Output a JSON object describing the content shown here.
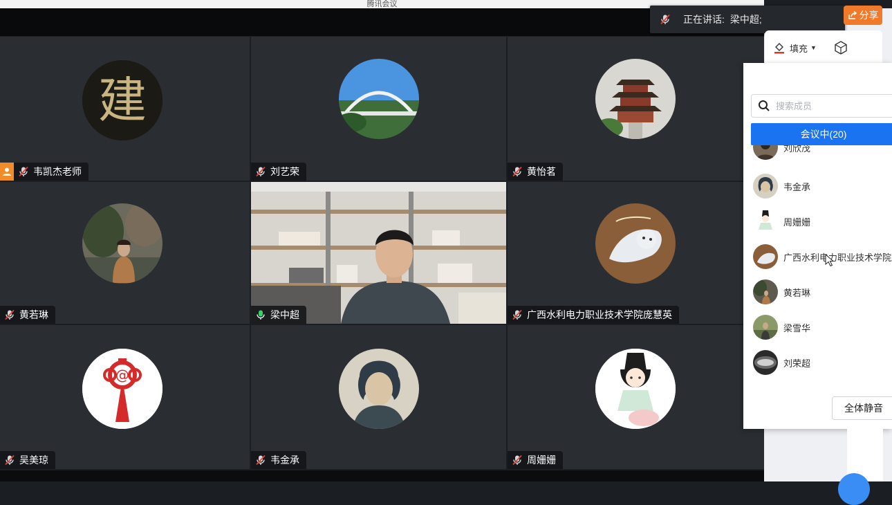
{
  "window": {
    "title": "腾讯会议"
  },
  "speaking": {
    "label": "正在讲话:",
    "name": "梁中超;"
  },
  "toolbar": {
    "share_label": "分享",
    "fill_label": "填充"
  },
  "tiles": [
    {
      "name": "韦凯杰老师",
      "mic": "muted",
      "host": true,
      "avatar": "calligraphy-avatar"
    },
    {
      "name": "刘艺荣",
      "mic": "muted",
      "host": false,
      "avatar": "bridge-avatar"
    },
    {
      "name": "黄怡茗",
      "mic": "muted",
      "host": false,
      "avatar": "pavilion-avatar"
    },
    {
      "name": "黄若琳",
      "mic": "muted",
      "host": false,
      "avatar": "portrait-avatar"
    },
    {
      "name": "梁中超",
      "mic": "active",
      "host": false,
      "avatar": "camera-video"
    },
    {
      "name": "广西水利电力职业技术学院庞慧英",
      "mic": "muted",
      "host": false,
      "avatar": "cat-avatar"
    },
    {
      "name": "吴美琼",
      "mic": "muted",
      "host": false,
      "avatar": "chinese-knot-avatar"
    },
    {
      "name": "韦金承",
      "mic": "muted",
      "host": false,
      "avatar": "sketch-avatar"
    },
    {
      "name": "周姗姗",
      "mic": "muted",
      "host": false,
      "avatar": "cartoon-avatar"
    }
  ],
  "members_panel": {
    "search_placeholder": "搜索成员",
    "tab_label": "会议中(20)",
    "members": [
      {
        "name": "刘欣茂"
      },
      {
        "name": "韦金承"
      },
      {
        "name": "周姗姗"
      },
      {
        "name": "广西水利电力职业技术学院庞"
      },
      {
        "name": "黄若琳"
      },
      {
        "name": "梁雪华"
      },
      {
        "name": "刘荣超"
      }
    ],
    "mute_all_label": "全体静音"
  },
  "colors": {
    "accent": "#1a73f0",
    "share": "#f07a2a",
    "active_speaker": "#2fc364",
    "host_badge": "#f08c2a"
  }
}
